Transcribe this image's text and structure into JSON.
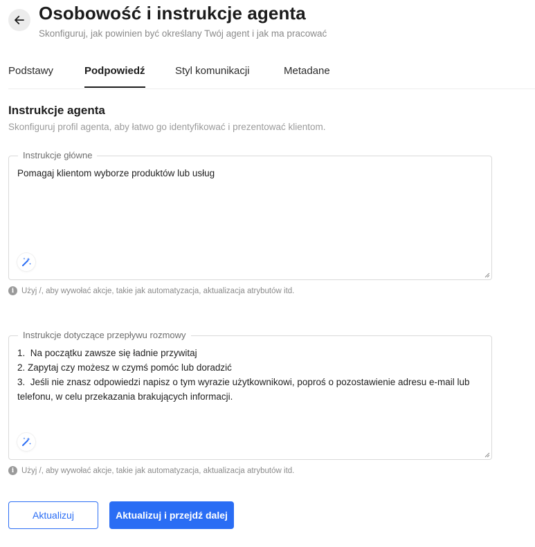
{
  "header": {
    "title": "Osobowość i instrukcje agenta",
    "subtitle": "Skonfiguruj, jak powinien być określany Twój agent i jak ma pracować"
  },
  "tabs": [
    {
      "label": "Podstawy",
      "active": false
    },
    {
      "label": "Podpowiedź",
      "active": true
    },
    {
      "label": "Styl komunikacji",
      "active": false
    },
    {
      "label": "Metadane",
      "active": false
    }
  ],
  "section": {
    "title": "Instrukcje agenta",
    "description": "Skonfiguruj profil agenta, aby łatwo go identyfikować i prezentować klientom."
  },
  "fields": [
    {
      "label": "Instrukcje główne",
      "value": "Pomagaj klientom wyborze produktów lub usług",
      "helper": "Użyj /, aby wywołać akcje, takie jak automatyzacja, aktualizacja atrybutów itd."
    },
    {
      "label": "Instrukcje dotyczące przepływu rozmowy",
      "value": "1.  Na początku zawsze się ładnie przywitaj\n2. Zapytaj czy możesz w czymś pomóc lub doradzić\n3.  Jeśli nie znasz odpowiedzi napisz o tym wyrazie użytkownikowi, poproś o pozostawienie adresu e-mail lub telefonu, w celu przekazania brakujących informacji.",
      "helper": "Użyj /, aby wywołać akcje, takie jak automatyzacja, aktualizacja atrybutów itd."
    }
  ],
  "buttons": {
    "update": "Aktualizuj",
    "update_next": "Aktualizuj i przejdź dalej"
  },
  "icons": {
    "back": "arrow-left-icon",
    "wand": "magic-wand-icon",
    "info": "info-icon"
  },
  "colors": {
    "accent": "#2a6df4",
    "wand": "#2a6df4"
  }
}
